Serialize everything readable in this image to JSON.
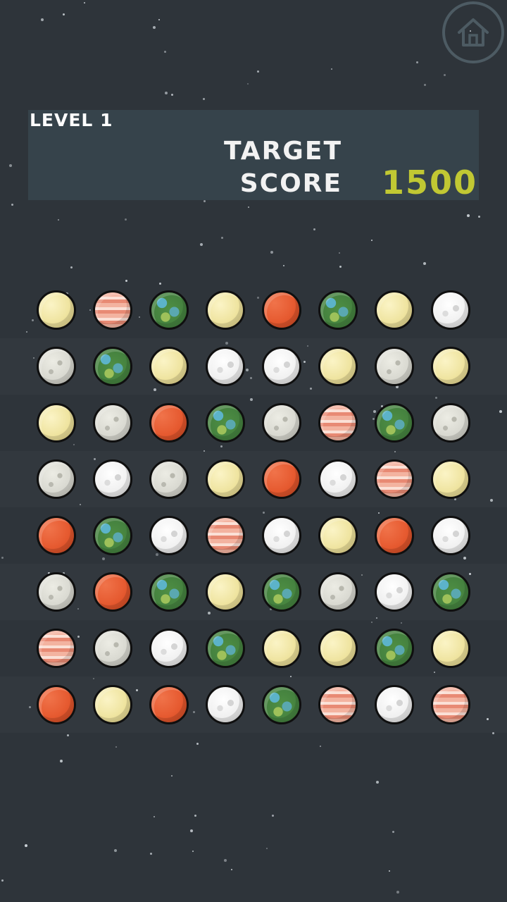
{
  "header": {
    "home_icon": "home-icon",
    "level_label": "LEVEL 1",
    "target_label": "TARGET\nSCORE",
    "target_value": "1500"
  },
  "colors": {
    "background": "#2e343a",
    "panel": "#36434b",
    "target_value": "#c1c833",
    "home_ring": "#4d5b63"
  },
  "planet_types": {
    "sand": "sand-planet-icon",
    "jupiter": "gas-giant-planet-icon",
    "earth": "earth-planet-icon",
    "mars": "mars-planet-icon",
    "moon": "gray-moon-icon",
    "ice": "ice-planet-icon"
  },
  "board": [
    [
      "sand",
      "jupiter",
      "earth",
      "sand",
      "mars",
      "earth",
      "sand",
      "ice"
    ],
    [
      "moon",
      "earth",
      "sand",
      "ice",
      "ice",
      "sand",
      "moon",
      "sand"
    ],
    [
      "sand",
      "moon",
      "mars",
      "earth",
      "moon",
      "jupiter",
      "earth",
      "moon"
    ],
    [
      "moon",
      "ice",
      "moon",
      "sand",
      "mars",
      "ice",
      "jupiter",
      "sand"
    ],
    [
      "mars",
      "earth",
      "ice",
      "jupiter",
      "ice",
      "sand",
      "mars",
      "ice"
    ],
    [
      "moon",
      "mars",
      "earth",
      "sand",
      "earth",
      "moon",
      "ice",
      "earth"
    ],
    [
      "jupiter",
      "moon",
      "ice",
      "earth",
      "sand",
      "sand",
      "earth",
      "sand"
    ],
    [
      "mars",
      "sand",
      "mars",
      "ice",
      "earth",
      "jupiter",
      "ice",
      "jupiter"
    ]
  ]
}
